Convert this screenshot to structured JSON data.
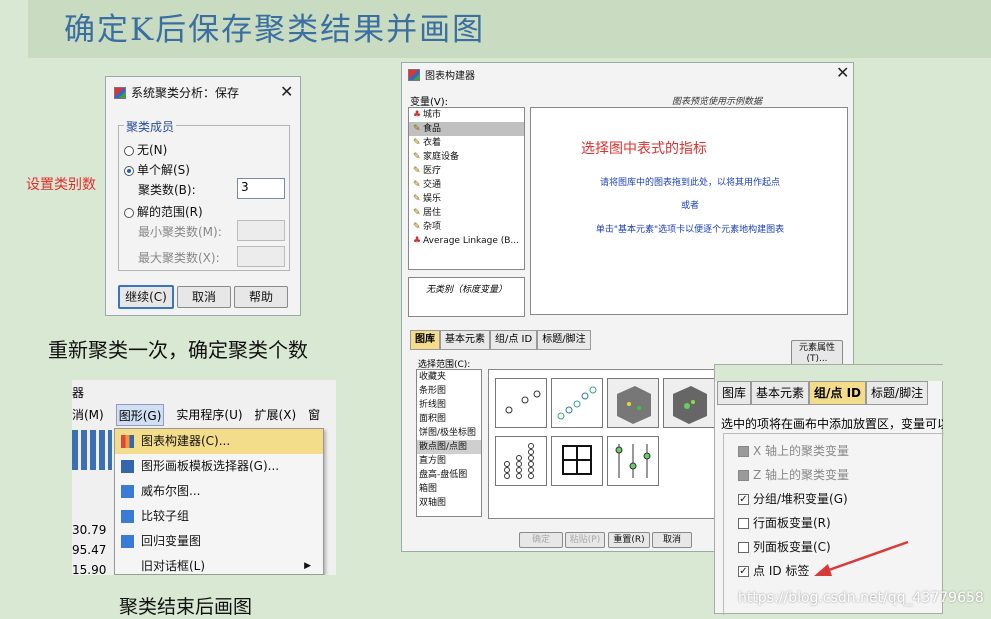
{
  "slide": {
    "title": "确定K后保存聚类结果并画图",
    "set_cluster_note": "设置类别数",
    "caption_recluster": "重新聚类一次，确定聚类个数",
    "caption_plot": "聚类结束后画图",
    "watermark": "https://blog.csdn.net/qq_43779658"
  },
  "save_dialog": {
    "title": "系统聚类分析：保存",
    "group_title": "聚类成员",
    "opt_none": "无(N)",
    "opt_single": "单个解(S)",
    "num_clusters_label": "聚类数(B):",
    "num_clusters_value": "3",
    "opt_range": "解的范围(R)",
    "min_label": "最小聚类数(M):",
    "max_label": "最大聚类数(X):",
    "btn_continue": "继续(C)",
    "btn_cancel": "取消",
    "btn_help": "帮助"
  },
  "chart_builder": {
    "title": "图表构建器",
    "variables_label": "变量(V):",
    "preview_label": "图表预览使用示例数据",
    "variables": [
      "城市",
      "食品",
      "衣着",
      "家庭设备",
      "医疗",
      "交通",
      "娱乐",
      "居住",
      "杂项",
      "Average Linkage (B..."
    ],
    "no_category": "无类别（标度变量）",
    "annotation": "选择图中表式的指标",
    "hint1": "请将图库中的图表拖到此处，以将其用作起点",
    "hint2": "或者",
    "hint3": "单击\"基本元素\"选项卡以便逐个元素地构建图表",
    "tabs": [
      "图库",
      "基本元素",
      "组/点 ID",
      "标题/脚注"
    ],
    "element_props": "元素属性(T)...",
    "choose_from": "选择范围(C):",
    "gallery": [
      "收藏夹",
      "条形图",
      "折线图",
      "面积图",
      "饼图/极坐标图",
      "散点图/点图",
      "直方图",
      "盘高-盘低图",
      "箱图",
      "双轴图"
    ],
    "btn_ok": "确定",
    "btn_paste": "粘贴(P)",
    "btn_reset": "重置(R)",
    "btn_cancel": "取消"
  },
  "menu": {
    "frag_top": "器",
    "menubar": [
      "消(M)",
      "图形(G)",
      "实用程序(U)",
      "扩展(X)",
      "窗"
    ],
    "items": [
      "图表构建器(C)...",
      "图形画板模板选择器(G)...",
      "威布尔图...",
      "比较子组",
      "回归变量图",
      "旧对话框(L)"
    ],
    "bg_values": [
      "30.79",
      "95.47",
      "15.90"
    ]
  },
  "groups_panel": {
    "tabs": [
      "图库",
      "基本元素",
      "组/点 ID",
      "标题/脚注"
    ],
    "description": "选中的项将在画布中添加放置区，变量可以",
    "options": [
      {
        "label": "X 轴上的聚类变量",
        "checked": false,
        "disabled": true
      },
      {
        "label": "Z 轴上的聚类变量",
        "checked": false,
        "disabled": true
      },
      {
        "label": "分组/堆积变量(G)",
        "checked": true,
        "disabled": false
      },
      {
        "label": "行面板变量(R)",
        "checked": false,
        "disabled": false
      },
      {
        "label": "列面板变量(C)",
        "checked": false,
        "disabled": false
      },
      {
        "label": "点 ID 标签",
        "checked": true,
        "disabled": false
      }
    ]
  },
  "colors": {
    "accent_red": "#e03030",
    "title_blue": "#3a6fa0",
    "menu_highlight": "#f3dc8a"
  }
}
